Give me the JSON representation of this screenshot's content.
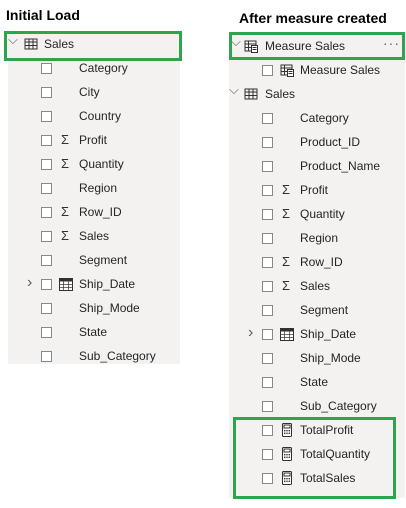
{
  "left": {
    "heading": "Initial Load",
    "table_name": "Sales",
    "fields": [
      {
        "label": "Category",
        "type": "text"
      },
      {
        "label": "City",
        "type": "text"
      },
      {
        "label": "Country",
        "type": "text"
      },
      {
        "label": "Profit",
        "type": "sum"
      },
      {
        "label": "Quantity",
        "type": "sum"
      },
      {
        "label": "Region",
        "type": "text"
      },
      {
        "label": "Row_ID",
        "type": "sum"
      },
      {
        "label": "Sales",
        "type": "sum"
      },
      {
        "label": "Segment",
        "type": "text"
      },
      {
        "label": "Ship_Date",
        "type": "date"
      },
      {
        "label": "Ship_Mode",
        "type": "text"
      },
      {
        "label": "State",
        "type": "text"
      },
      {
        "label": "Sub_Category",
        "type": "text"
      }
    ]
  },
  "right": {
    "heading": "After measure created",
    "measure_table_name": "Measure Sales",
    "measure_table_more": "···",
    "measure_table_child": "Measure Sales",
    "table_name": "Sales",
    "fields": [
      {
        "label": "Category",
        "type": "text"
      },
      {
        "label": "Product_ID",
        "type": "text"
      },
      {
        "label": "Product_Name",
        "type": "text"
      },
      {
        "label": "Profit",
        "type": "sum"
      },
      {
        "label": "Quantity",
        "type": "sum"
      },
      {
        "label": "Region",
        "type": "text"
      },
      {
        "label": "Row_ID",
        "type": "sum"
      },
      {
        "label": "Sales",
        "type": "sum"
      },
      {
        "label": "Segment",
        "type": "text"
      },
      {
        "label": "Ship_Date",
        "type": "date"
      },
      {
        "label": "Ship_Mode",
        "type": "text"
      },
      {
        "label": "State",
        "type": "text"
      },
      {
        "label": "Sub_Category",
        "type": "text"
      }
    ],
    "measures": [
      {
        "label": "TotalProfit"
      },
      {
        "label": "TotalQuantity"
      },
      {
        "label": "TotalSales"
      }
    ]
  },
  "icons": {
    "chevron_expanded": "chevron-down-icon",
    "chevron_collapsed": "chevron-right-icon",
    "table": "table-icon",
    "measure_table": "measure-table-icon",
    "calculator": "calculator-icon",
    "sigma": "sigma-icon",
    "calendar": "calendar-icon"
  },
  "colors": {
    "highlight_border": "#2ea44f",
    "panel_bg": "#f3f2f1"
  }
}
